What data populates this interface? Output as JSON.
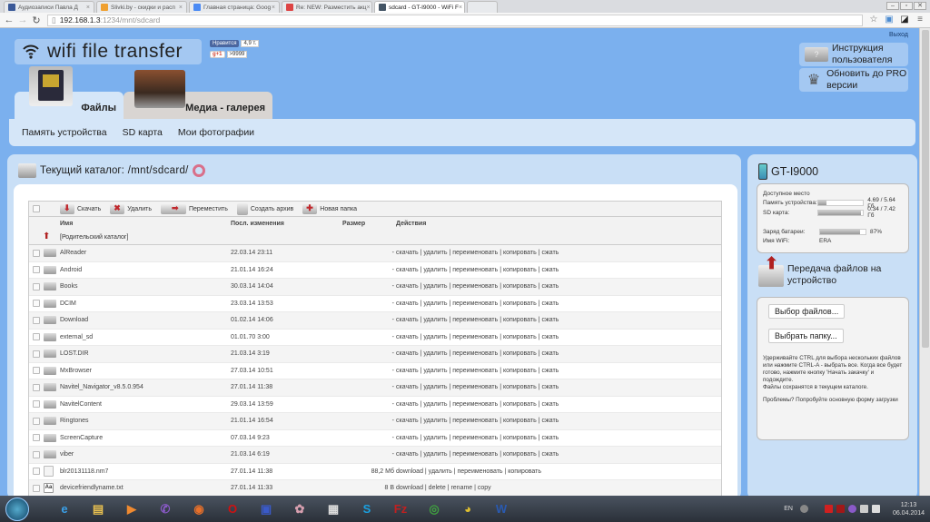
{
  "browser": {
    "tabs": [
      {
        "label": "Аудиозаписи Павла Д",
        "color": "#3b5998",
        "active": false
      },
      {
        "label": "Slivki.by - скидки и расп",
        "color": "#f0a030",
        "active": false
      },
      {
        "label": "Главная страница: Goog",
        "color": "#4a8af4",
        "active": false
      },
      {
        "label": "Re: NEW: Разместить акц",
        "color": "#d44",
        "active": false
      },
      {
        "label": "sdcard - GT-I9000 - WiFi F",
        "color": "#456",
        "active": true
      }
    ],
    "url_host": "192.168.1.3",
    "url_rest": ":1234/mnt/sdcard",
    "win_buttons": [
      "–",
      "▫",
      "✕"
    ]
  },
  "header": {
    "logout": "Выход",
    "app_title": "wifi file transfer",
    "facebook_like": "Нравится",
    "facebook_count": "4,9 т.",
    "gplus_label": "g+1",
    "gplus_count": ">9999",
    "user_manual": "Инструкция пользователя",
    "upgrade_pro": "Обновить до PRO версии"
  },
  "tabs": [
    {
      "label": "Файлы",
      "active": true
    },
    {
      "label": "Медиа - галерея",
      "active": false
    }
  ],
  "subnav": [
    "Память устройства",
    "SD карта",
    "Мои фотографии"
  ],
  "main": {
    "current_dir_label": "Текущий каталог:",
    "current_dir": "/mnt/sdcard/",
    "toolbar": {
      "download": "Скачать",
      "delete": "Удалить",
      "move": "Переместить",
      "archive": "Создать архив",
      "new_folder": "Новая папка"
    },
    "columns": {
      "name": "Имя",
      "modified": "Посл. изменения",
      "size": "Размер",
      "actions": "Действия"
    },
    "parent_dir": "[Родительский каталог]",
    "rows": [
      {
        "type": "folder",
        "name": "AlReader",
        "date": "22.03.14 23:11",
        "size": "-",
        "actions": "скачать | удалить | переименовать | копировать | сжать"
      },
      {
        "type": "folder",
        "name": "Android",
        "date": "21.01.14 16:24",
        "size": "-",
        "actions": "скачать | удалить | переименовать | копировать | сжать"
      },
      {
        "type": "folder",
        "name": "Books",
        "date": "30.03.14 14:04",
        "size": "-",
        "actions": "скачать | удалить | переименовать | копировать | сжать"
      },
      {
        "type": "folder",
        "name": "DCIM",
        "date": "23.03.14 13:53",
        "size": "-",
        "actions": "скачать | удалить | переименовать | копировать | сжать"
      },
      {
        "type": "folder",
        "name": "Download",
        "date": "01.02.14 14:06",
        "size": "-",
        "actions": "скачать | удалить | переименовать | копировать | сжать"
      },
      {
        "type": "folder",
        "name": "external_sd",
        "date": "01.01.70 3:00",
        "size": "-",
        "actions": "скачать | удалить | переименовать | копировать | сжать"
      },
      {
        "type": "folder",
        "name": "LOST.DIR",
        "date": "21.03.14 3:19",
        "size": "-",
        "actions": "скачать | удалить | переименовать | копировать | сжать"
      },
      {
        "type": "folder",
        "name": "MxBrowser",
        "date": "27.03.14 10:51",
        "size": "-",
        "actions": "скачать | удалить | переименовать | копировать | сжать"
      },
      {
        "type": "folder",
        "name": "Navitel_Navigator_v8.5.0.954",
        "date": "27.01.14 11:38",
        "size": "-",
        "actions": "скачать | удалить | переименовать | копировать | сжать"
      },
      {
        "type": "folder",
        "name": "NavitelContent",
        "date": "29.03.14 13:59",
        "size": "-",
        "actions": "скачать | удалить | переименовать | копировать | сжать"
      },
      {
        "type": "folder",
        "name": "Ringtones",
        "date": "21.01.14 16:54",
        "size": "-",
        "actions": "скачать | удалить | переименовать | копировать | сжать"
      },
      {
        "type": "folder",
        "name": "ScreenCapture",
        "date": "07.03.14 9:23",
        "size": "-",
        "actions": "скачать | удалить | переименовать | копировать | сжать"
      },
      {
        "type": "folder",
        "name": "viber",
        "date": "21.03.14 6:19",
        "size": "-",
        "actions": "скачать | удалить | переименовать | копировать | сжать"
      },
      {
        "type": "file",
        "name": "blr20131118.nm7",
        "date": "27.01.14 11:38",
        "size": "88,2 Мб",
        "actions": "download | удалить | переименовать | копировать"
      },
      {
        "type": "txt",
        "name": "devicefriendlyname.txt",
        "date": "27.01.14 11:33",
        "size": "8 B",
        "actions": "download | delete | rename | copy"
      }
    ]
  },
  "side": {
    "device": "GT-I9000",
    "free_space": "Доступное место",
    "device_mem_label": "Память устройства:",
    "device_mem_value": "4.69 / 5.64 Гб",
    "device_mem_used_fraction": 0.17,
    "sd_label": "SD карта:",
    "sd_value": "0.34 / 7.42 Гб",
    "sd_used_fraction": 0.95,
    "battery_label": "Заряд батареи:",
    "battery_value": "87%",
    "battery_fraction": 0.87,
    "wifi_label": "Имя WiFi:",
    "wifi_value": "ERA",
    "upload_title": "Передача файлов на устройство",
    "choose_files": "Выбор файлов...",
    "choose_folder": "Выбрать папку...",
    "help_text": "Удерживайте CTRL для выбора нескольких файлов или нажмите CTRL-A - выбрать все. Когда все будет готово, нажмите кнопку 'Начать закачку' и подождите.",
    "save_note": "Файлы сохранятся в текущем каталоге.",
    "problems": "Проблемы? Попробуйте основную форму загрузки"
  },
  "taskbar": {
    "apps": [
      {
        "name": "internet-explorer",
        "glyph": "e",
        "color": "#3aa0e8"
      },
      {
        "name": "file-explorer",
        "glyph": "▤",
        "color": "#e8c050"
      },
      {
        "name": "media-player",
        "glyph": "▶",
        "color": "#f08a30"
      },
      {
        "name": "viber",
        "glyph": "✆",
        "color": "#8a5ac8"
      },
      {
        "name": "firefox",
        "glyph": "◉",
        "color": "#e8702a"
      },
      {
        "name": "opera",
        "glyph": "O",
        "color": "#d01010"
      },
      {
        "name": "save-app",
        "glyph": "▣",
        "color": "#3a5ac8"
      },
      {
        "name": "paint",
        "glyph": "✿",
        "color": "#d8a0b0"
      },
      {
        "name": "media-classic",
        "glyph": "▦",
        "color": "#ddd"
      },
      {
        "name": "skype",
        "glyph": "S",
        "color": "#1aa0e0"
      },
      {
        "name": "filezilla",
        "glyph": "Fz",
        "color": "#c02020"
      },
      {
        "name": "chrome",
        "glyph": "◎",
        "color": "#40a040"
      },
      {
        "name": "webcam",
        "glyph": "◕",
        "color": "#e0c030"
      },
      {
        "name": "word",
        "glyph": "W",
        "color": "#2a5ab0"
      }
    ],
    "lang": "EN",
    "time": "12:13",
    "date": "06.04.2014"
  }
}
